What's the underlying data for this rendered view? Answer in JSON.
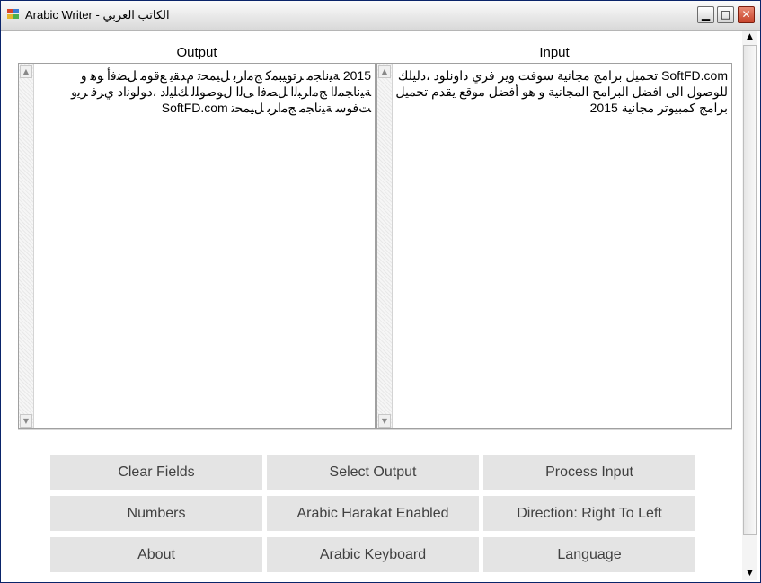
{
  "window": {
    "title": "Arabic Writer - الكاتب العربي",
    "icon": "app-icon",
    "controls": [
      "minimize-icon",
      "maximize-icon",
      "close-icon"
    ]
  },
  "panes": {
    "output_label": "Output",
    "input_label": "Input",
    "output_text": "2015 ﺔﻴﻧﺎﺠﻣ ﺮﺗﻮﻴﺒﻤﻛ ﺞﻣاﺮﺑ ﻞﻴﻤﺤﺗ مﺪﻘﻳ ﻊﻗﻮﻣ ﻞﻀﻓأ ﻮﻫ و ﺔﻴﻧﺎﺠﻤﻟا ﺞﻣاﺮﺒﻟا ﻞﻀﻓا ﻰﻟا لﻮﺻﻮﻠﻟ ﻚﻠﻴﻟد ،دﻮﻟﻮﻧاد يﺮﻓ ﺮﻳو ﺖﻓﻮﺳ ﺔﻴﻧﺎﺠﻣ ﺞﻣاﺮﺑ ﻞﻴﻤﺤﺗ SoftFD.com",
    "input_text": "SoftFD.com تحميل برامج مجانية سوفت وير فري داونلود ،دليلك للوصول الى افضل البرامج المجانية و هو أفضل موقع يقدم تحميل برامج كمبيوتر مجانية 2015"
  },
  "buttons": {
    "clear_fields": "Clear Fields",
    "select_output": "Select Output",
    "process_input": "Process Input",
    "numbers": "Numbers",
    "arabic_harakat": "Arabic Harakat Enabled",
    "direction": "Direction: Right To Left",
    "about": "About",
    "arabic_keyboard": "Arabic Keyboard",
    "language": "Language"
  },
  "colors": {
    "button_bg": "#e4e4e4",
    "button_text": "#404040",
    "window_border": "#0a246a",
    "close_button": "#c8432b"
  }
}
